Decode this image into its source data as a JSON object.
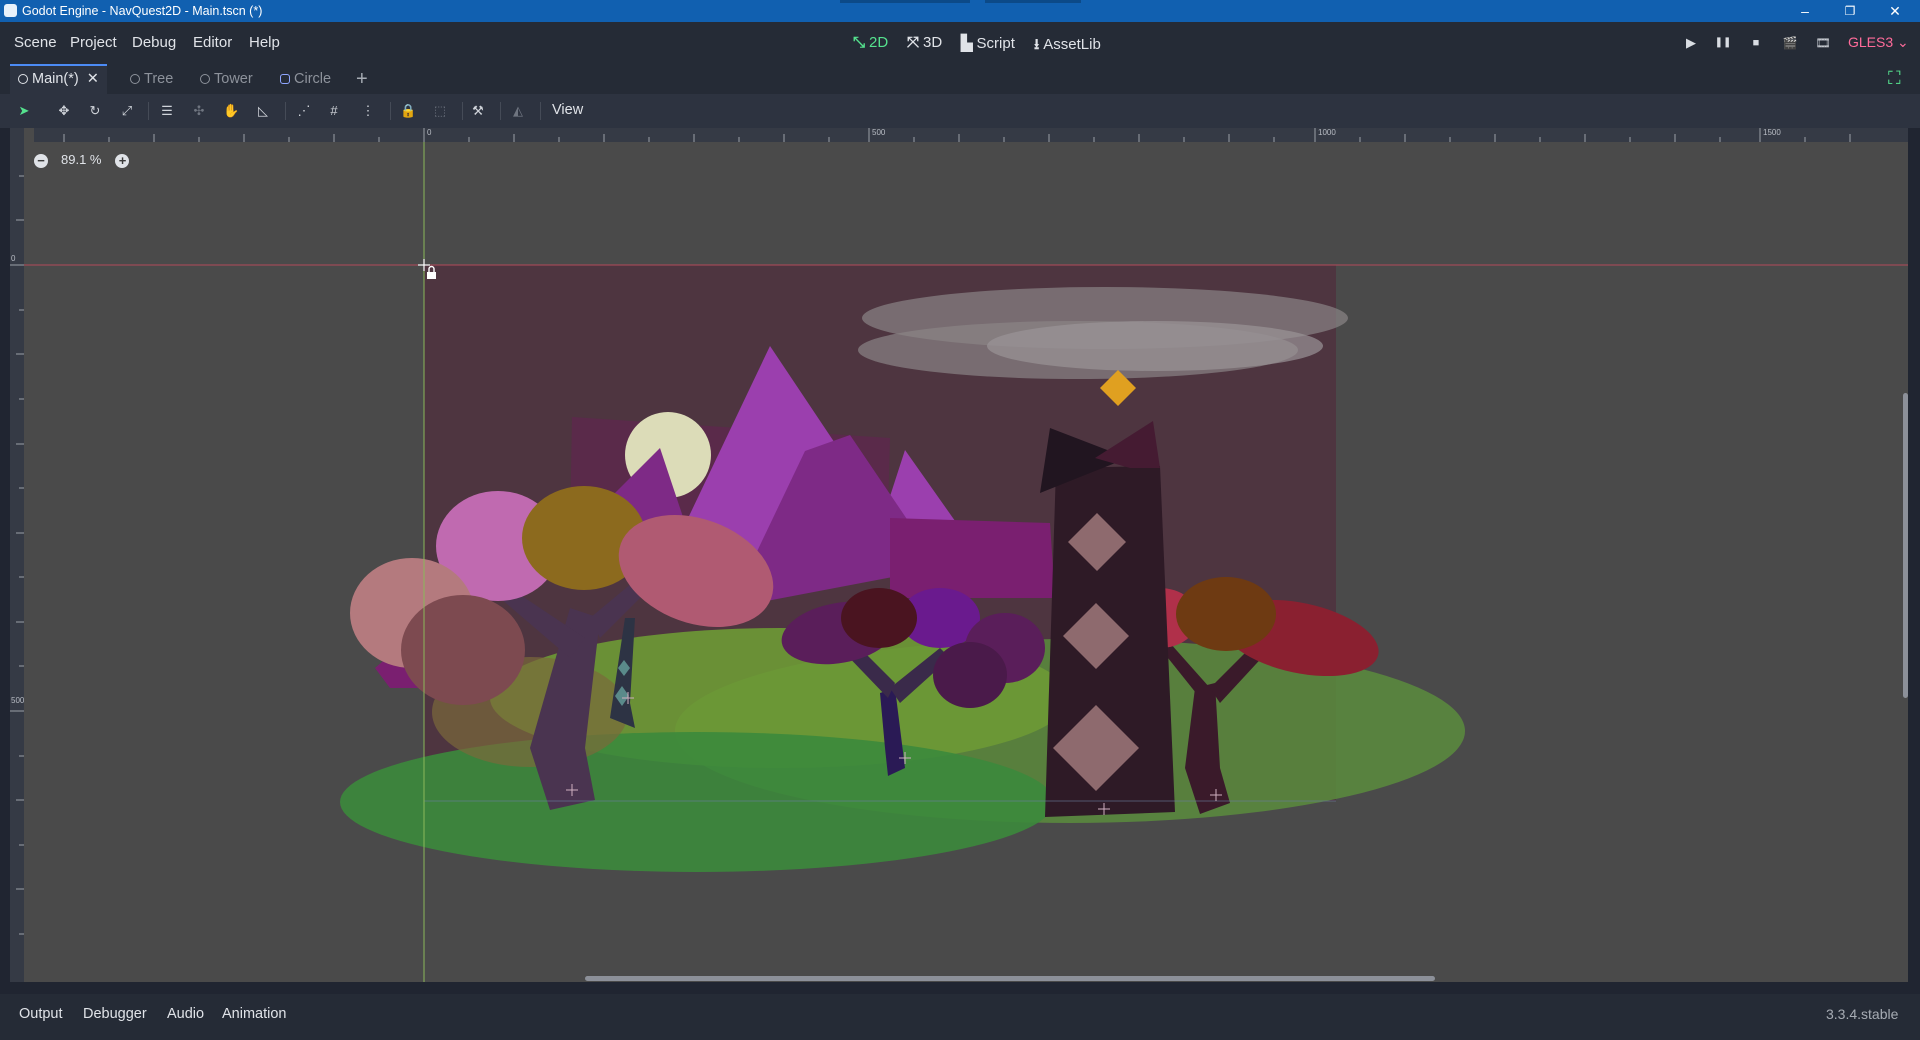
{
  "window": {
    "title": "Godot Engine - NavQuest2D - Main.tscn (*)",
    "minimize": "–",
    "restore": "❐",
    "close": "✕"
  },
  "menubar": {
    "items": [
      "Scene",
      "Project",
      "Debug",
      "Editor",
      "Help"
    ]
  },
  "workspaces": [
    {
      "glyph": "⤡",
      "label": "2D",
      "active": true
    },
    {
      "glyph": "⤧",
      "label": "3D",
      "active": false
    },
    {
      "glyph": "▙",
      "label": "Script",
      "active": false
    },
    {
      "glyph": "⭳",
      "label": "AssetLib",
      "active": false
    }
  ],
  "run_controls": {
    "play": "▶",
    "pause": "❚❚",
    "stop": "■",
    "play_scene": "🎬",
    "play_custom": "🎞",
    "renderer": "GLES3 ⌄"
  },
  "scene_tabs": {
    "tabs": [
      {
        "label": "Main(*)",
        "active": true,
        "icon": "node-circle-icon",
        "close": "✕"
      },
      {
        "label": "Tree",
        "active": false,
        "icon": "node-circle-icon"
      },
      {
        "label": "Tower",
        "active": false,
        "icon": "node-circle-icon"
      },
      {
        "label": "Circle",
        "active": false,
        "icon": "sprite-icon"
      }
    ],
    "add_tab": "+",
    "distraction_free": "⛶"
  },
  "toolbar": {
    "view_menu": "View"
  },
  "viewport": {
    "zoom": "89.1 %",
    "zoom_out": "−",
    "zoom_in": "+",
    "ruler_labels": [
      "0",
      "500",
      "1000",
      "1500"
    ],
    "vruler_labels": [
      "0",
      "500"
    ]
  },
  "bottom_panel": {
    "tabs": [
      "Output",
      "Debugger",
      "Audio",
      "Animation"
    ],
    "version": "3.3.4.stable"
  },
  "colors": {
    "accent": "#55e28e",
    "titlebar": "#1160b0",
    "gles": "#ff6b9a",
    "viewport_bg": "#4a4a4a"
  }
}
